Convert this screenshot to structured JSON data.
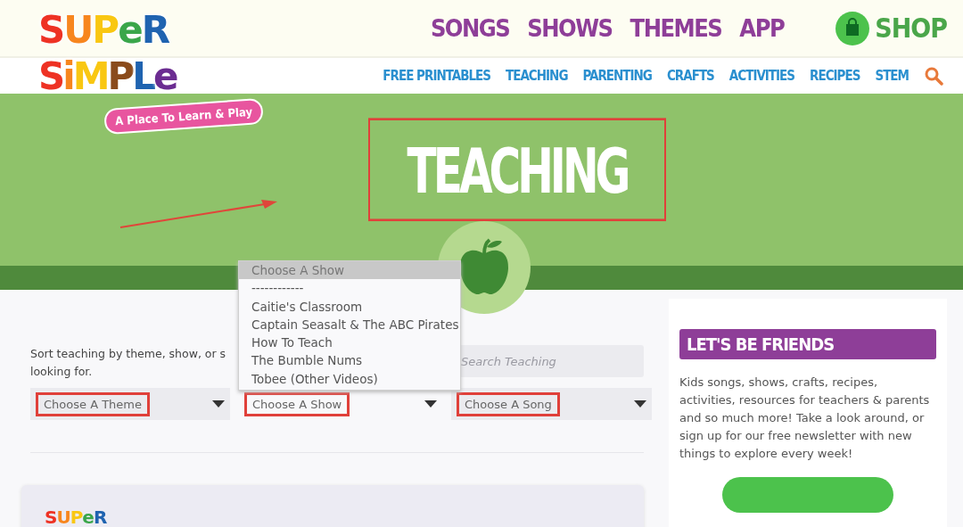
{
  "logo": {
    "line_1": "SUPeR",
    "line_2": "SiMPLe",
    "tagline": "A Place To Learn & Play"
  },
  "main_nav": [
    {
      "label": "SONGS"
    },
    {
      "label": "SHOWS"
    },
    {
      "label": "THEMES"
    },
    {
      "label": "APP"
    }
  ],
  "shop": {
    "label": "SHOP"
  },
  "sub_nav": [
    {
      "label": "FREE PRINTABLES"
    },
    {
      "label": "TEACHING"
    },
    {
      "label": "PARENTING"
    },
    {
      "label": "CRAFTS"
    },
    {
      "label": "ACTIVITIES"
    },
    {
      "label": "RECIPES"
    },
    {
      "label": "STEM"
    }
  ],
  "hero": {
    "title": "TEACHING",
    "highlighted": true
  },
  "filters": {
    "intro_lines": [
      "Sort teaching by theme, show, or s",
      "looking for."
    ],
    "search": {
      "placeholder": "Search Teaching"
    },
    "selects": [
      {
        "value": "Choose A Theme",
        "open": false,
        "highlighted": true
      },
      {
        "value": "Choose A Show",
        "open": true,
        "highlighted": true
      },
      {
        "value": "Choose A Song",
        "open": false,
        "highlighted": true
      }
    ],
    "dropdown_options": [
      {
        "label": "Choose A Show",
        "selected": true
      },
      {
        "label": "------------",
        "selected": false
      },
      {
        "label": "Caitie's Classroom",
        "selected": false
      },
      {
        "label": "Captain Seasalt & The ABC Pirates",
        "selected": false
      },
      {
        "label": "How To Teach",
        "selected": false
      },
      {
        "label": "The Bumble Nums",
        "selected": false
      },
      {
        "label": "Tobee (Other Videos)",
        "selected": false
      }
    ]
  },
  "card": {
    "logo_text": "SUPeR"
  },
  "sidebar": {
    "heading": "LET'S BE FRIENDS",
    "text": "Kids songs, shows, crafts, recipes, activities, resources for teachers & parents and so much more! Take a look around, or sign up for our free newsletter with new things to explore every week!"
  }
}
